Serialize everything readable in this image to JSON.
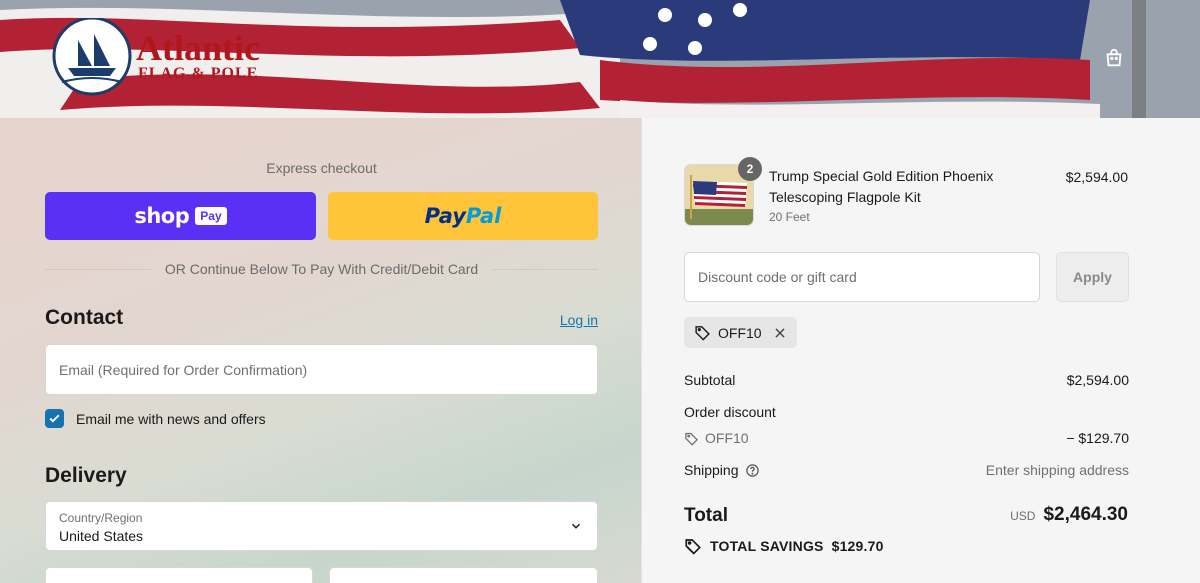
{
  "header": {
    "logo_text_1": "Atlantic",
    "logo_text_2": "FLAG & POLE",
    "cart_icon": "shopping-bag-icon"
  },
  "express": {
    "title": "Express checkout",
    "shop_pay_word": "shop",
    "shop_pay_badge": "Pay",
    "paypal_1": "Pay",
    "paypal_2": "Pal",
    "divider_text": "OR Continue Below To Pay With Credit/Debit Card"
  },
  "contact": {
    "title": "Contact",
    "login_link": "Log in",
    "email_placeholder": "Email (Required for Order Confirmation)",
    "newsletter_label": "Email me with news and offers",
    "newsletter_checked": true
  },
  "delivery": {
    "title": "Delivery",
    "country_label": "Country/Region",
    "country_value": "United States"
  },
  "summary": {
    "product": {
      "title": "Trump Special Gold Edition Phoenix Telescoping Flagpole Kit",
      "variant": "20 Feet",
      "price": "$2,594.00",
      "quantity": "2"
    },
    "discount_placeholder": "Discount code or gift card",
    "apply_label": "Apply",
    "applied_code": "OFF10",
    "subtotal_label": "Subtotal",
    "subtotal_value": "$2,594.00",
    "order_discount_label": "Order discount",
    "discount_code": "OFF10",
    "discount_value": "− $129.70",
    "shipping_label": "Shipping",
    "shipping_value": "Enter shipping address",
    "total_label": "Total",
    "currency": "USD",
    "total_value": "$2,464.30",
    "savings_label": "TOTAL SAVINGS",
    "savings_value": "$129.70"
  },
  "colors": {
    "shop_pay": "#5a31f4",
    "paypal": "#ffc439",
    "link": "#1773b0",
    "checkbox": "#1773b0"
  }
}
